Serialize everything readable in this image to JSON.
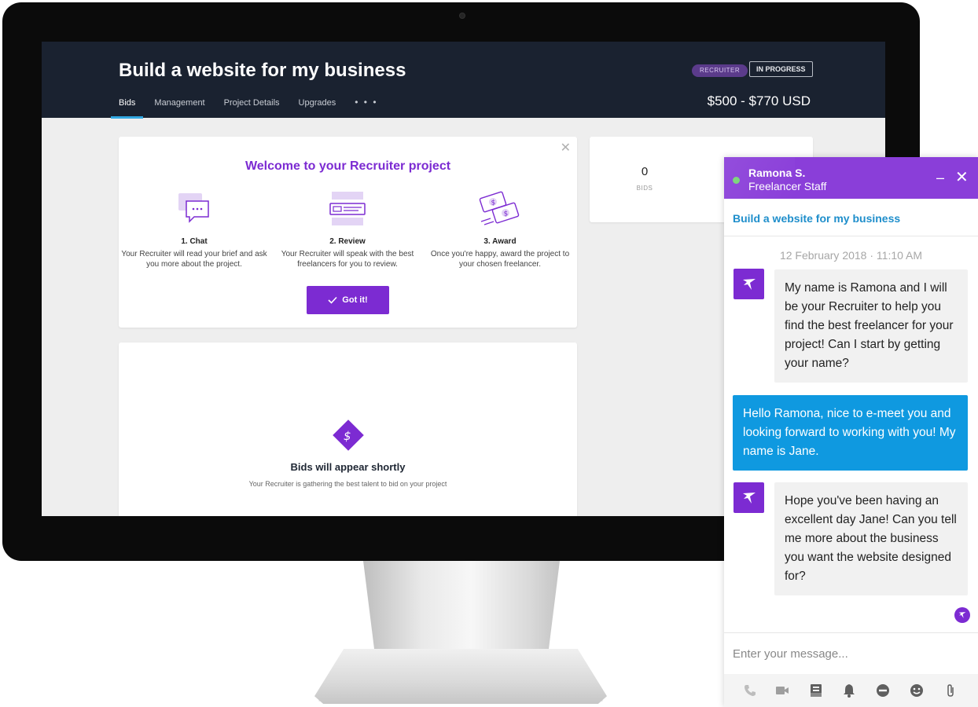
{
  "project": {
    "title": "Build a website for my business",
    "role_badge": "RECRUITER",
    "status": "IN PROGRESS",
    "budget": "$500 - $770 USD"
  },
  "nav": {
    "tabs": [
      {
        "label": "Bids",
        "active": true
      },
      {
        "label": "Management",
        "active": false
      },
      {
        "label": "Project Details",
        "active": false
      },
      {
        "label": "Upgrades",
        "active": false
      }
    ],
    "more": "• • •"
  },
  "welcome": {
    "close": "✕",
    "title": "Welcome to your Recruiter project",
    "steps": [
      {
        "title": "1. Chat",
        "desc": "Your Recruiter will read your brief and ask you more about the project."
      },
      {
        "title": "2. Review",
        "desc": "Your Recruiter will speak with the best freelancers for you to review."
      },
      {
        "title": "3. Award",
        "desc": "Once you're happy, award the project to your chosen freelancer."
      }
    ],
    "button_label": "Got it!"
  },
  "bids": {
    "heading": "Bids will appear shortly",
    "subtext": "Your Recruiter is gathering the best talent to bid on your project"
  },
  "stats": {
    "bid_count": "0",
    "bid_label": "BIDS"
  },
  "chat": {
    "agent_name": "Ramona S.",
    "agent_role": "Freelancer Staff",
    "minimize": "–",
    "close": "✕",
    "project_title": "Build a website for my business",
    "timestamp": "12 February 2018 · 11:10 AM",
    "messages": [
      {
        "from": "agent",
        "text": "My name is Ramona and I will be your Recruiter to help you find the best freelancer for your project! Can I start by getting your name?"
      },
      {
        "from": "user",
        "text": "Hello Ramona, nice to e-meet you and looking forward to working with you! My name is Jane."
      },
      {
        "from": "agent",
        "text": "Hope you've been having an excellent day Jane! Can you tell me more about the business you want the website designed for?"
      }
    ],
    "input_placeholder": "Enter your message...",
    "toolbar": [
      "phone-icon",
      "video-icon",
      "file-icon",
      "bell-icon",
      "block-icon",
      "emoji-icon",
      "attach-icon"
    ]
  },
  "colors": {
    "brand_purple": "#7c2bd2",
    "header_dark": "#1a2230",
    "chat_blue": "#0f99e0",
    "link_blue": "#1e8ecb"
  }
}
